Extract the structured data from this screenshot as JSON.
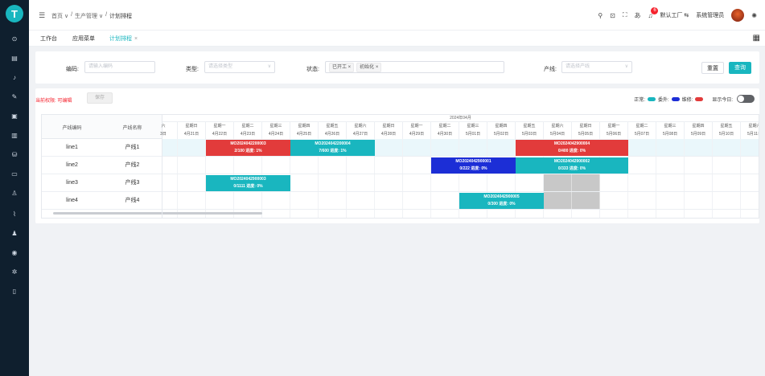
{
  "sidebar": {
    "logo": "T",
    "icons": [
      "home-icon",
      "document-icon",
      "chart-icon",
      "tools-icon",
      "list-icon",
      "bar-chart-icon",
      "cart-icon",
      "device-icon",
      "user-icon",
      "trend-icon",
      "people-icon",
      "settings-icon",
      "gear-icon",
      "phone-icon"
    ]
  },
  "topbar": {
    "breadcrumb": [
      "首页 ∨",
      "/",
      "生产管理 ∨",
      "/",
      "计划排程"
    ],
    "notif_count": "6",
    "factory": "默认工厂 ⇆",
    "user": "系统管理员"
  },
  "tabs": [
    {
      "label": "工作台",
      "active": false
    },
    {
      "label": "应用菜单",
      "active": false
    },
    {
      "label": "计划排程",
      "active": true
    }
  ],
  "filters": {
    "code_label": "编码:",
    "code_placeholder": "请输入编码",
    "type_label": "类型:",
    "type_placeholder": "请选择类型",
    "status_label": "状态:",
    "status_chips": [
      "已开工 ×",
      "初始化 ×"
    ],
    "line_label": "产线:",
    "line_placeholder": "请选择产线",
    "reset": "重置",
    "query": "查询"
  },
  "toolbar": {
    "permission": "当前权限: 可编辑",
    "save": "保存",
    "legend_normal": "正常:",
    "legend_outsource": "委外:",
    "legend_repair": "维修:",
    "show_today": "显示今日:",
    "colors": {
      "normal": "#19b6bf",
      "outsource": "#1c2ed6",
      "repair": "#e23b3b"
    }
  },
  "gantt": {
    "col_code": "产线编码",
    "col_name": "产线名称",
    "month": "2024年04月",
    "days": [
      {
        "wd": "六",
        "dt": "3日"
      },
      {
        "wd": "星期日",
        "dt": "4月21日"
      },
      {
        "wd": "星期一",
        "dt": "4月22日"
      },
      {
        "wd": "星期二",
        "dt": "4月23日"
      },
      {
        "wd": "星期三",
        "dt": "4月24日"
      },
      {
        "wd": "星期四",
        "dt": "4月25日"
      },
      {
        "wd": "星期五",
        "dt": "4月26日"
      },
      {
        "wd": "星期六",
        "dt": "4月27日"
      },
      {
        "wd": "星期日",
        "dt": "4月28日"
      },
      {
        "wd": "星期一",
        "dt": "4月29日"
      },
      {
        "wd": "星期二",
        "dt": "4月30日"
      },
      {
        "wd": "星期三",
        "dt": "5月01日"
      },
      {
        "wd": "星期四",
        "dt": "5月02日"
      },
      {
        "wd": "星期五",
        "dt": "5月03日"
      },
      {
        "wd": "星期六",
        "dt": "5月04日"
      },
      {
        "wd": "星期日",
        "dt": "5月05日"
      },
      {
        "wd": "星期一",
        "dt": "5月06日"
      },
      {
        "wd": "星期二",
        "dt": "5月07日"
      },
      {
        "wd": "星期三",
        "dt": "5月08日"
      },
      {
        "wd": "星期四",
        "dt": "5月09日"
      },
      {
        "wd": "星期五",
        "dt": "5月10日"
      },
      {
        "wd": "星期六",
        "dt": "5月11日"
      }
    ],
    "rows": [
      {
        "code": "line1",
        "name": "产线1"
      },
      {
        "code": "line2",
        "name": "产线2"
      },
      {
        "code": "line3",
        "name": "产线3"
      },
      {
        "code": "line4",
        "name": "产线4"
      }
    ],
    "bars": [
      {
        "row": 0,
        "start": 2,
        "span": 3,
        "color": "#e23b3b",
        "title": "MO2024042200003",
        "info": "2/100 进度: 1%"
      },
      {
        "row": 0,
        "start": 5,
        "span": 3,
        "color": "#19b6bf",
        "title": "MO2024042200004",
        "info": "7/600 进度: 1%"
      },
      {
        "row": 0,
        "start": 13,
        "span": 4,
        "color": "#e23b3b",
        "title": "MO2024042900004",
        "info": "0/400 进度: 0%"
      },
      {
        "row": 1,
        "start": 10,
        "span": 3,
        "color": "#1c2ed6",
        "title": "MO2024042900001",
        "info": "0/222 进度: 0%"
      },
      {
        "row": 1,
        "start": 13,
        "span": 4,
        "color": "#19b6bf",
        "title": "MO2024042900002",
        "info": "0/333 进度: 0%"
      },
      {
        "row": 2,
        "start": 2,
        "span": 3,
        "color": "#19b6bf",
        "title": "MO2024042900003",
        "info": "0/1111 进度: 0%"
      },
      {
        "row": 3,
        "start": 11,
        "span": 3,
        "color": "#19b6bf",
        "title": "MO2024042900005",
        "info": "0/300 进度: 0%"
      }
    ],
    "gray": [
      {
        "row": 2,
        "start": 14,
        "span": 2
      },
      {
        "row": 3,
        "start": 14,
        "span": 2
      }
    ]
  }
}
